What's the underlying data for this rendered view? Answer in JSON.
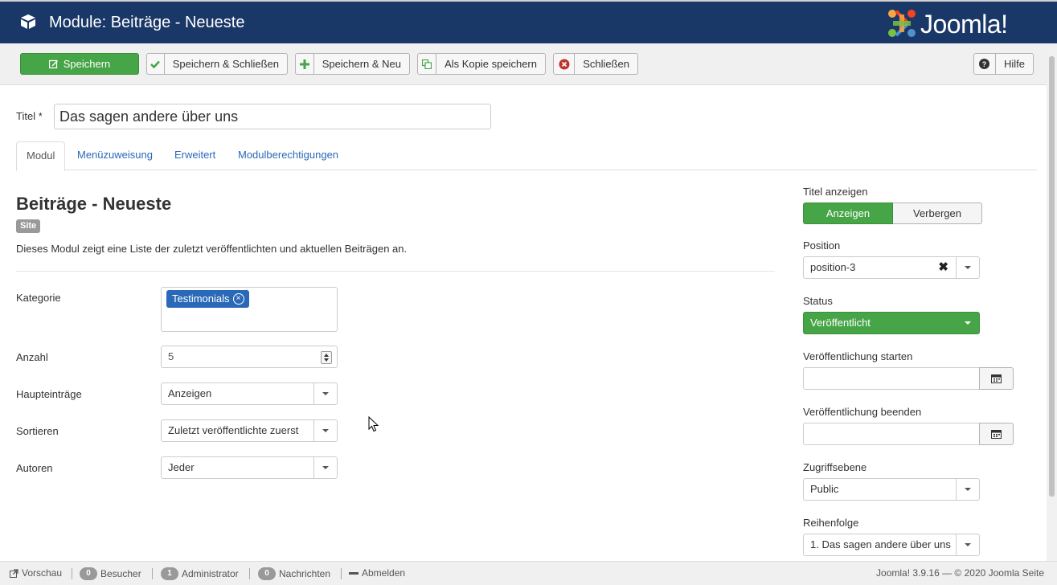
{
  "header": {
    "title": "Module: Beiträge - Neueste",
    "brand": "Joomla!"
  },
  "toolbar": {
    "save": "Speichern",
    "save_close": "Speichern & Schließen",
    "save_new": "Speichern & Neu",
    "save_copy": "Als Kopie speichern",
    "close": "Schließen",
    "help": "Hilfe"
  },
  "title_field": {
    "label": "Titel *",
    "value": "Das sagen andere über uns"
  },
  "tabs": [
    {
      "label": "Modul"
    },
    {
      "label": "Menüzuweisung"
    },
    {
      "label": "Erweitert"
    },
    {
      "label": "Modulberechtigungen"
    }
  ],
  "module": {
    "heading": "Beiträge - Neueste",
    "badge": "Site",
    "description": "Dieses Modul zeigt eine Liste der zuletzt veröffentlichten und aktuellen Beiträgen an."
  },
  "fields": {
    "kategorie": {
      "label": "Kategorie",
      "tag": "Testimonials"
    },
    "anzahl": {
      "label": "Anzahl",
      "value": "5"
    },
    "haupteintraege": {
      "label": "Haupteinträge",
      "value": "Anzeigen"
    },
    "sortieren": {
      "label": "Sortieren",
      "value": "Zuletzt veröffentlichte zuerst"
    },
    "autoren": {
      "label": "Autoren",
      "value": "Jeder"
    }
  },
  "sidebar": {
    "show_title": {
      "label": "Titel anzeigen",
      "on": "Anzeigen",
      "off": "Verbergen"
    },
    "position": {
      "label": "Position",
      "value": "position-3"
    },
    "status": {
      "label": "Status",
      "value": "Veröffentlicht"
    },
    "publish_up": {
      "label": "Veröffentlichung starten"
    },
    "publish_down": {
      "label": "Veröffentlichung beenden"
    },
    "access": {
      "label": "Zugriffsebene",
      "value": "Public"
    },
    "ordering": {
      "label": "Reihenfolge",
      "value": "1. Das sagen andere über uns"
    }
  },
  "footer": {
    "preview": "Vorschau",
    "visitors_count": "0",
    "visitors": "Besucher",
    "admin_count": "1",
    "admin": "Administrator",
    "messages_count": "0",
    "messages": "Nachrichten",
    "logout": "Abmelden",
    "copyright": "Joomla! 3.9.16 — © 2020 Joomla Seite"
  },
  "colors": {
    "header_bg": "#1a3867",
    "success": "#46a546",
    "link": "#2a69b8"
  }
}
